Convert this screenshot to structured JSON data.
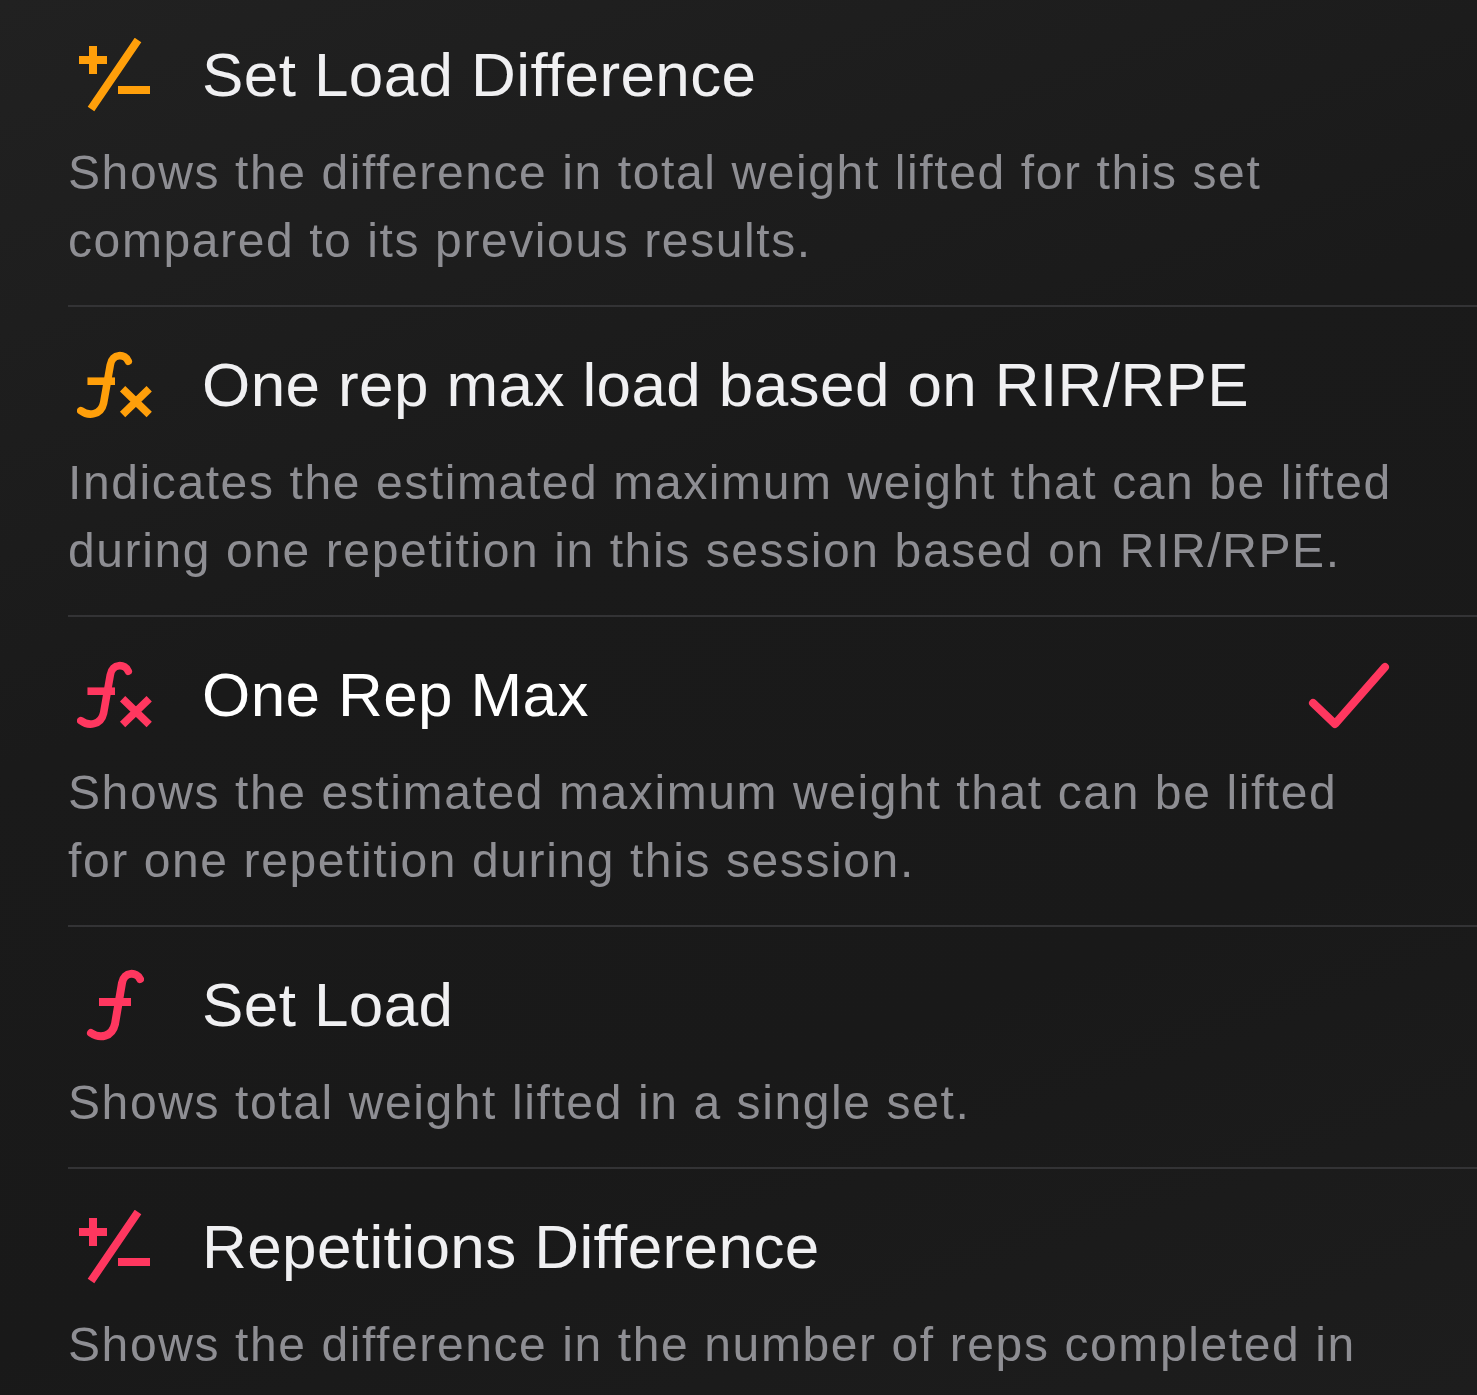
{
  "metrics": [
    {
      "kind": "plus-minus",
      "color": "#ff9f0a",
      "title": "Set Load Difference",
      "description": "Shows the difference in total weight lifted for this set compared to its previous results.",
      "selected": false
    },
    {
      "kind": "fx",
      "color": "#ff9f0a",
      "title": "One rep max load based on RIR/RPE",
      "description": "Indicates the estimated maximum weight that can be lifted during one repetition in this session based on RIR/RPE.",
      "selected": false
    },
    {
      "kind": "fx",
      "color": "#ff375f",
      "title": "One Rep Max",
      "description": "Shows the estimated maximum weight that can be lifted for one repetition during this session.",
      "selected": true
    },
    {
      "kind": "f",
      "color": "#ff375f",
      "title": "Set Load",
      "description": "Shows total weight lifted in a single set.",
      "selected": false
    },
    {
      "kind": "plus-minus",
      "color": "#ff375f",
      "title": "Repetitions Difference",
      "description": "Shows the difference in the number of reps completed in",
      "selected": false
    }
  ]
}
